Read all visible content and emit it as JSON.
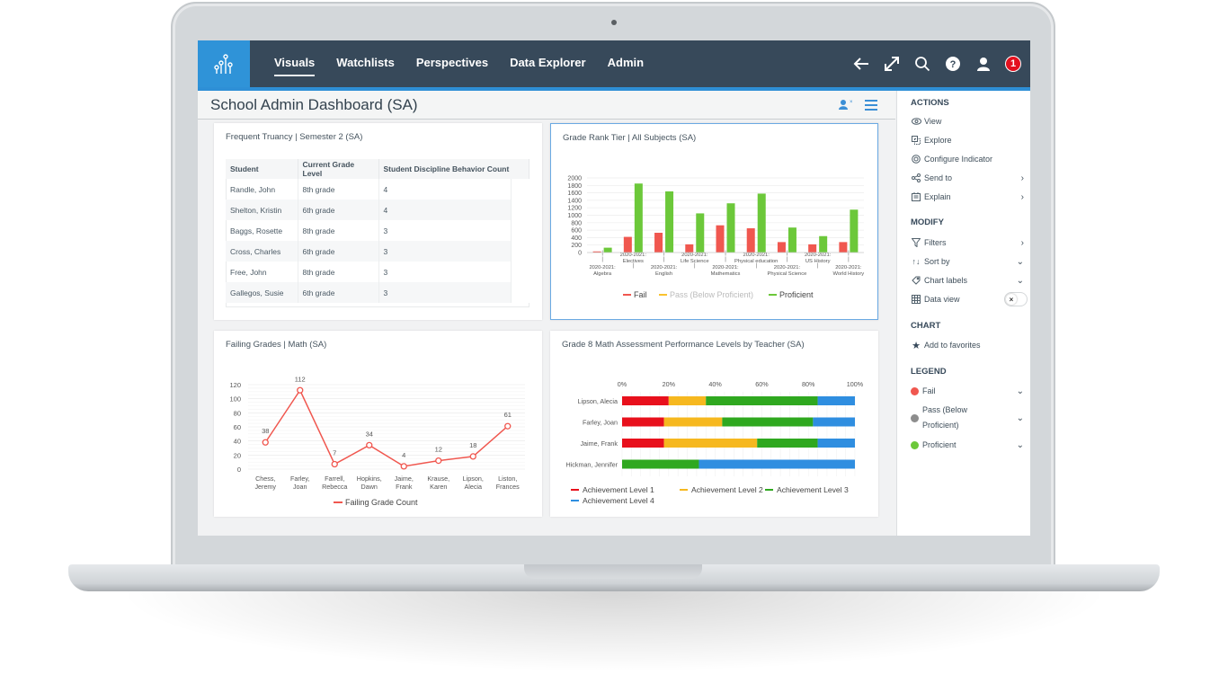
{
  "nav": {
    "items": [
      {
        "label": "Visuals",
        "active": true
      },
      {
        "label": "Watchlists",
        "active": false
      },
      {
        "label": "Perspectives",
        "active": false
      },
      {
        "label": "Data Explorer",
        "active": false
      },
      {
        "label": "Admin",
        "active": false
      }
    ],
    "icons": [
      "back-arrow-icon",
      "expand-icon",
      "search-icon",
      "help-icon",
      "user-icon"
    ],
    "notification_count": "1"
  },
  "dashboard": {
    "title": "School Admin Dashboard (SA)"
  },
  "truancy": {
    "title": "Frequent Truancy | Semester 2 (SA)",
    "columns": [
      "Student",
      "Current Grade Level",
      "Student Discipline Behavior Count"
    ],
    "rows": [
      [
        "Randle, John",
        "8th grade",
        "4"
      ],
      [
        "Shelton, Kristin",
        "6th grade",
        "4"
      ],
      [
        "Baggs, Rosette",
        "8th grade",
        "3"
      ],
      [
        "Cross, Charles",
        "6th grade",
        "3"
      ],
      [
        "Free, John",
        "8th grade",
        "3"
      ],
      [
        "Gallegos, Susie",
        "6th grade",
        "3"
      ]
    ]
  },
  "chart_data": [
    {
      "type": "bar",
      "title": "Grade Rank Tier | All Subjects (SA)",
      "categories": [
        "2020-2021: Algebra",
        "2020-2021: Electives",
        "2020-2021: English",
        "2020-2021: Life Science",
        "2020-2021: Mathematics",
        "2020-2021: Physical education",
        "2020-2021: Physical Science",
        "2020-2021: US History",
        "2020-2021: World History"
      ],
      "category_lines": [
        [
          "2020-2021:",
          "Algebra"
        ],
        [
          "2020-2021:",
          "Electives"
        ],
        [
          "2020-2021:",
          "English"
        ],
        [
          "2020-2021:",
          "Life Science"
        ],
        [
          "2020-2021:",
          "Mathematics"
        ],
        [
          "2020-2021:",
          "Physical education"
        ],
        [
          "2020-2021:",
          "Physical Science"
        ],
        [
          "2020-2021:",
          "US History"
        ],
        [
          "2020-2021:",
          "World History"
        ]
      ],
      "series": [
        {
          "name": "Fail",
          "color": "#f0574f",
          "values": [
            30,
            420,
            530,
            220,
            730,
            650,
            280,
            220,
            280
          ]
        },
        {
          "name": "Pass (Below Proficient)",
          "color": "#f9c22e",
          "values": [
            0,
            0,
            0,
            0,
            0,
            0,
            0,
            0,
            0
          ],
          "hidden": true
        },
        {
          "name": "Proficient",
          "color": "#6cc83a",
          "values": [
            130,
            1850,
            1640,
            1050,
            1320,
            1580,
            670,
            440,
            1150
          ]
        }
      ],
      "yticks": [
        0,
        200,
        400,
        600,
        800,
        1000,
        1200,
        1400,
        1600,
        1800,
        2000
      ],
      "ylim": [
        0,
        2000
      ],
      "legend": "bottom",
      "grid": true
    },
    {
      "type": "line",
      "title": "Failing Grades | Math (SA)",
      "categories": [
        "Chess, Jeremy",
        "Farley, Joan",
        "Farrell, Rebecca",
        "Hopkins, Dawn",
        "Jaime, Frank",
        "Krause, Karen",
        "Lipson, Alecia",
        "Liston, Frances"
      ],
      "category_lines": [
        [
          "Chess,",
          "Jeremy"
        ],
        [
          "Farley,",
          "Joan"
        ],
        [
          "Farrell,",
          "Rebecca"
        ],
        [
          "Hopkins,",
          "Dawn"
        ],
        [
          "Jaime,",
          "Frank"
        ],
        [
          "Krause,",
          "Karen"
        ],
        [
          "Lipson,",
          "Alecia"
        ],
        [
          "Liston,",
          "Frances"
        ]
      ],
      "series": [
        {
          "name": "Failing Grade Count",
          "color": "#f0574f",
          "values": [
            38,
            112,
            7,
            34,
            4,
            12,
            18,
            61
          ]
        }
      ],
      "yticks": [
        0,
        20,
        40,
        60,
        80,
        100,
        120
      ],
      "ylim": [
        0,
        120
      ],
      "legend": "bottom",
      "grid": true,
      "data_labels": true
    },
    {
      "type": "bar",
      "orientation": "horizontal-stacked-percent",
      "title": "Grade 8 Math Assessment Performance Levels by Teacher (SA)",
      "categories": [
        "Lipson, Alecia",
        "Farley, Joan",
        "Jaime, Frank",
        "Hickman, Jennifer"
      ],
      "series": [
        {
          "name": "Achievement Level 1",
          "color": "#e8101c",
          "values": [
            20,
            18,
            18,
            0
          ]
        },
        {
          "name": "Achievement Level 2",
          "color": "#f6b81f",
          "values": [
            16,
            25,
            40,
            0
          ]
        },
        {
          "name": "Achievement Level 3",
          "color": "#2fa81f",
          "values": [
            48,
            39,
            26,
            33
          ]
        },
        {
          "name": "Achievement Level 4",
          "color": "#2f8ee0",
          "values": [
            16,
            18,
            16,
            67
          ]
        }
      ],
      "xticks": [
        "0%",
        "20%",
        "40%",
        "60%",
        "80%",
        "100%"
      ],
      "xlim": [
        0,
        100
      ],
      "legend": "bottom",
      "grid": true
    }
  ],
  "panel": {
    "actions_header": "ACTIONS",
    "actions": [
      {
        "label": "View",
        "icon": "eye-icon",
        "chevron": ""
      },
      {
        "label": "Explore",
        "icon": "explore-icon",
        "chevron": ""
      },
      {
        "label": "Configure Indicator",
        "icon": "configure-icon",
        "chevron": ""
      },
      {
        "label": "Send to",
        "icon": "share-icon",
        "chevron": "›"
      },
      {
        "label": "Explain",
        "icon": "explain-icon",
        "chevron": "›"
      }
    ],
    "modify_header": "MODIFY",
    "modify": [
      {
        "label": "Filters",
        "icon": "filter-icon",
        "chevron": "›"
      },
      {
        "label": "Sort by",
        "icon": "sort-icon",
        "chevron": "⌄"
      },
      {
        "label": "Chart labels",
        "icon": "tag-icon",
        "chevron": "⌄"
      },
      {
        "label": "Data view",
        "icon": "grid-icon",
        "toggle": false
      }
    ],
    "chart_header": "CHART",
    "chart": [
      {
        "label": "Add to favorites",
        "icon": "star-icon"
      }
    ],
    "legend_header": "LEGEND",
    "legend": [
      {
        "label": "Fail",
        "color": "#f0574f"
      },
      {
        "label": "Pass (Below Proficient)",
        "label_lines": [
          "Pass (Below",
          "Proficient)"
        ],
        "color": "#8d8d8d"
      },
      {
        "label": "Proficient",
        "color": "#6cc83a"
      }
    ],
    "toggle_off_glyph": "×"
  }
}
